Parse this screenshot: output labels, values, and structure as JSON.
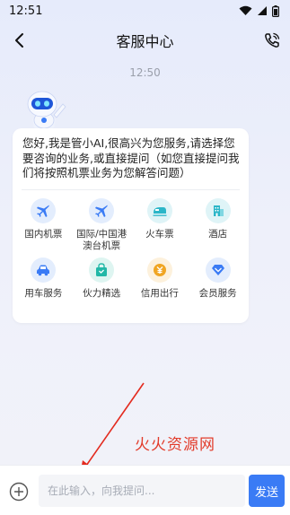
{
  "status_bar": {
    "time": "12:51"
  },
  "header": {
    "title": "客服中心"
  },
  "chat": {
    "timestamp": "12:50",
    "greeting": "您好,我是管小AI,很高兴为您服务,请选择您要咨询的业务,或直接提问（如您直接提问我们将按照机票业务为您解答问题）",
    "services": [
      {
        "label": "国内机票",
        "icon": "plane-icon",
        "color": "#3a7bf5",
        "bg": "#e3edfd"
      },
      {
        "label": "国际/中国港澳台机票",
        "icon": "plane-icon",
        "color": "#3a7bf5",
        "bg": "#e3edfd"
      },
      {
        "label": "火车票",
        "icon": "train-icon",
        "color": "#2bb6c8",
        "bg": "#dff4f7"
      },
      {
        "label": "酒店",
        "icon": "hotel-icon",
        "color": "#2bb6c8",
        "bg": "#dff4f7"
      },
      {
        "label": "用车服务",
        "icon": "car-icon",
        "color": "#3a7bf5",
        "bg": "#e3edfd"
      },
      {
        "label": "伙力精选",
        "icon": "shopping-bag-icon",
        "color": "#22b8a7",
        "bg": "#def5f1"
      },
      {
        "label": "信用出行",
        "icon": "credit-coin-icon",
        "color": "#f0a522",
        "bg": "#fdf1dc"
      },
      {
        "label": "会员服务",
        "icon": "member-diamond-icon",
        "color": "#3a7bf5",
        "bg": "#e3edfd"
      }
    ]
  },
  "watermark": "火火资源网",
  "input": {
    "placeholder": "在此输入，向我提问...",
    "value": ""
  },
  "send_label": "发送"
}
